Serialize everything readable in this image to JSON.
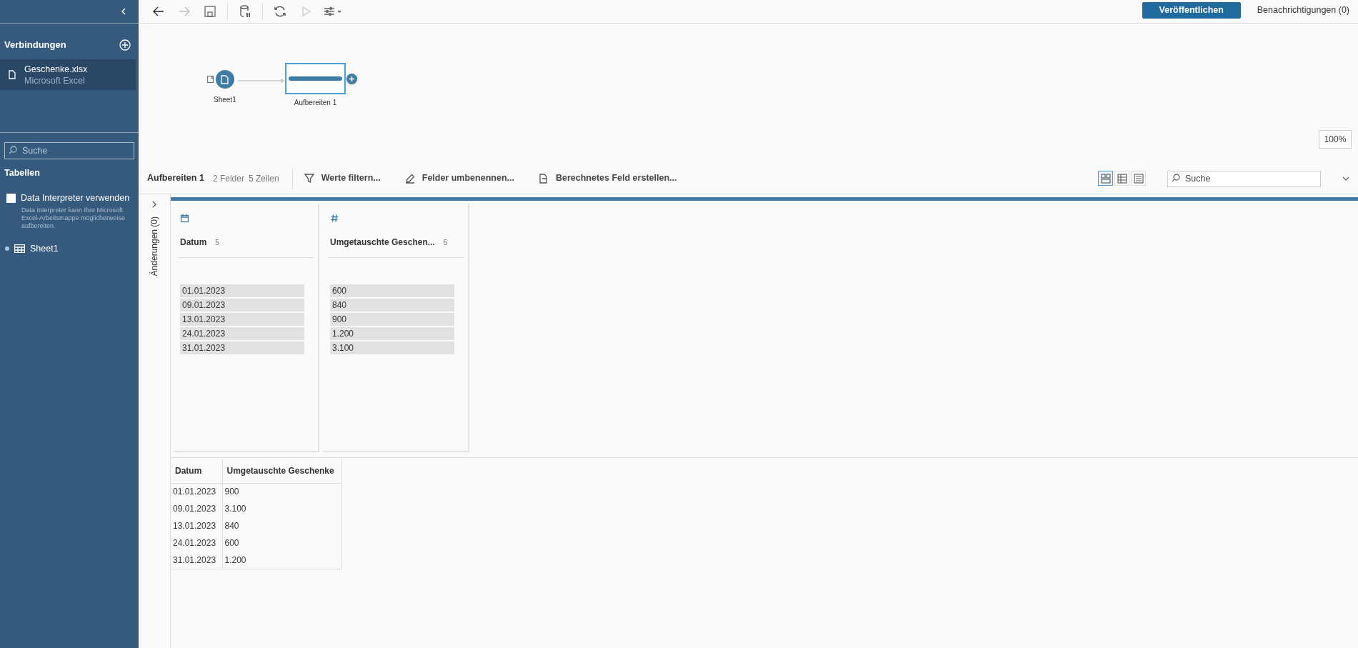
{
  "sidebar": {
    "connections_title": "Verbindungen",
    "connections": [
      {
        "name": "Geschenke.xlsx",
        "type": "Microsoft Excel",
        "selected": true
      }
    ],
    "search": {
      "placeholder": "Suche"
    },
    "tables_title": "Tabellen",
    "data_interpreter": {
      "label": "Data Interpreter verwenden",
      "checked": false,
      "description": "Data Interpreter kann Ihre Microsoft Excel-Arbeitsmappe möglicherweise aufbereiten."
    },
    "tables": [
      {
        "name": "Sheet1"
      }
    ]
  },
  "toolbar": {
    "publish_button": "Veröffentlichen",
    "notifications": "Benachrichtigungen (0)"
  },
  "flow": {
    "nodes": [
      {
        "kind": "input",
        "label": "Sheet1",
        "selected": false
      },
      {
        "kind": "clean",
        "label": "Aufbereiten 1",
        "selected": true
      }
    ],
    "zoom": "100%"
  },
  "profile": {
    "title": "Aufbereiten 1",
    "fields_count": "2 Felder",
    "rows_count": "5 Zeilen",
    "actions": [
      {
        "kind": "filter",
        "label": "Werte filtern..."
      },
      {
        "kind": "rename",
        "label": "Felder umbenennen..."
      },
      {
        "kind": "calc",
        "label": "Berechnetes Feld erstellen..."
      }
    ],
    "view_modes": [
      {
        "kind": "profile",
        "selected": true
      },
      {
        "kind": "table",
        "selected": false
      },
      {
        "kind": "list",
        "selected": false
      }
    ],
    "search": {
      "placeholder": "Suche"
    },
    "changes_label": "Änderungen (0)",
    "cards": [
      {
        "kind": "date",
        "name": "Datum",
        "count": "5",
        "values": [
          "01.01.2023",
          "09.01.2023",
          "13.01.2023",
          "24.01.2023",
          "31.01.2023"
        ]
      },
      {
        "kind": "number",
        "name": "Umgetauschte Geschen...",
        "count": "5",
        "values": [
          "600",
          "840",
          "900",
          "1.200",
          "3.100"
        ]
      }
    ]
  },
  "data_grid": {
    "columns": [
      "Datum",
      "Umgetauschte Geschenke"
    ],
    "rows": [
      [
        "01.01.2023",
        "900"
      ],
      [
        "09.01.2023",
        "3.100"
      ],
      [
        "13.01.2023",
        "840"
      ],
      [
        "24.01.2023",
        "600"
      ],
      [
        "31.01.2023",
        "1.200"
      ]
    ]
  }
}
